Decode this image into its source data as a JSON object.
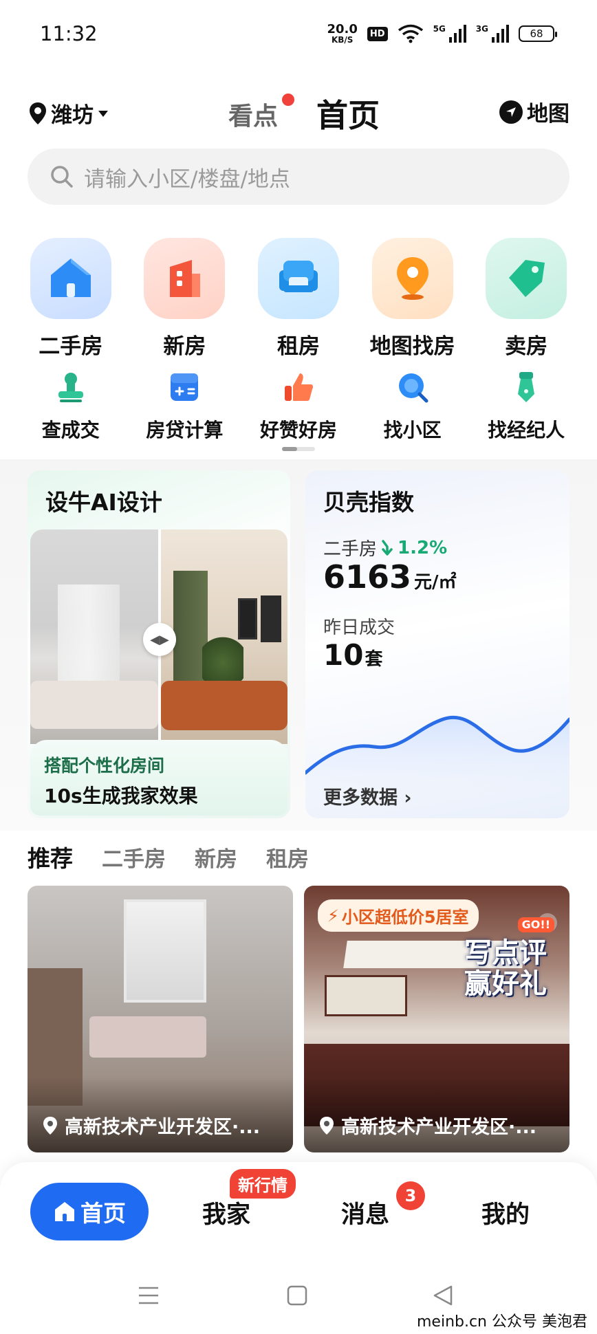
{
  "status_bar": {
    "time": "11:32",
    "net_speed_value": "20.0",
    "net_speed_unit": "KB/S",
    "hd": "HD",
    "signal_1": "5G",
    "signal_2": "3G",
    "battery": "68"
  },
  "header": {
    "city": "潍坊",
    "tab_kandian": "看点",
    "tab_home": "首页",
    "map_label": "地图"
  },
  "search": {
    "placeholder": "请输入小区/楼盘/地点"
  },
  "big_categories": [
    {
      "label": "二手房",
      "icon": "house-icon"
    },
    {
      "label": "新房",
      "icon": "building-icon"
    },
    {
      "label": "租房",
      "icon": "sofa-icon"
    },
    {
      "label": "地图找房",
      "icon": "map-pin-icon"
    },
    {
      "label": "卖房",
      "icon": "price-tag-icon"
    }
  ],
  "small_categories": [
    {
      "label": "查成交",
      "icon": "stamp-icon"
    },
    {
      "label": "房贷计算",
      "icon": "calculator-icon"
    },
    {
      "label": "好赞好房",
      "icon": "thumbs-up-icon"
    },
    {
      "label": "找小区",
      "icon": "search-community-icon"
    },
    {
      "label": "找经纪人",
      "icon": "agent-tie-icon"
    }
  ],
  "ai_card": {
    "title": "设牛AI设计",
    "caption_line1": "搭配个性化房间",
    "caption_line2": "10s生成我家效果"
  },
  "index_card": {
    "title": "贝壳指数",
    "secondhand_label": "二手房",
    "change": "1.2%",
    "price": "6163",
    "price_unit": "元/㎡",
    "yesterday_label": "昨日成交",
    "yesterday_count": "10",
    "count_unit": "套",
    "more": "更多数据"
  },
  "recommend_tabs": [
    "推荐",
    "二手房",
    "新房",
    "租房"
  ],
  "listings": [
    {
      "location": "高新技术产业开发区·..."
    },
    {
      "location": "高新技术产业开发区·...",
      "promo": "小区超低价5居室",
      "review_line1": "写点评",
      "review_line2": "赢好礼",
      "go": "GO!!"
    }
  ],
  "bottom_nav": {
    "home": "首页",
    "my_home": "我家",
    "my_home_badge": "新行情",
    "messages": "消息",
    "messages_badge": "3",
    "me": "我的"
  },
  "watermark": "meinb.cn  公众号 美泡君",
  "colors": {
    "accent_blue": "#1f6cf2",
    "badge_red": "#f04235",
    "index_green": "#19a974"
  }
}
